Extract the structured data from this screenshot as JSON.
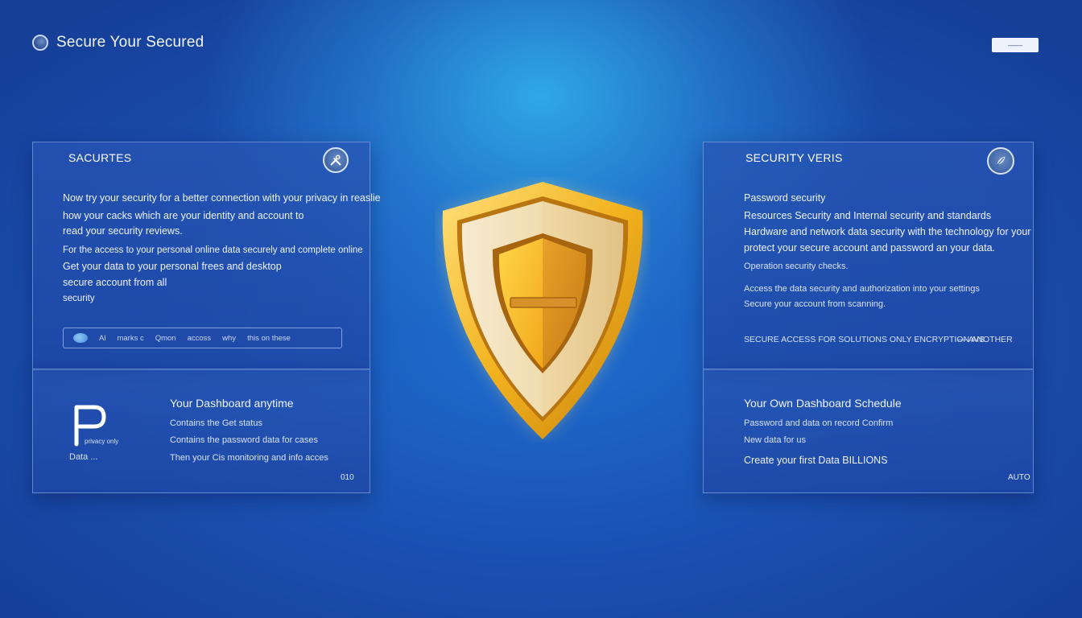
{
  "header": {
    "app_title": "Secure Your Secured",
    "top_button_label": "——"
  },
  "left_top": {
    "title": "SACURTES",
    "lines": [
      "Now try your security for a better connection with your privacy in reaslie",
      "how your cacks  which are your identity and account to",
      "read your security reviews.",
      "For the access to your personal online data securely and complete online",
      "Get your data to your personal frees and desktop",
      "secure account from all",
      "security"
    ],
    "search_tokens": [
      "Al",
      "marks c",
      "Qmon",
      "accoss",
      "why",
      "this on these"
    ]
  },
  "left_bottom": {
    "heading": "Your Dashboard anytime",
    "lines": [
      "Contains the Get status",
      "Contains the password data for cases",
      "Then your Cis monitoring and info acces"
    ],
    "glyph_caption": "privacy only",
    "glyph_label": "Data ...",
    "footer_num": "010"
  },
  "right_top": {
    "title": "SECURITY VERIS",
    "lines": [
      "Password security",
      "Resources Security and Internal security and standards",
      "Hardware and network data security with the technology for your",
      "protect your secure account and password an your data.",
      "Operation security checks.",
      "Access the data security and authorization into your settings",
      "Secure your account from scanning."
    ],
    "footer_line": "SECURE ACCESS FOR SOLUTIONS ONLY ENCRYPTION ANOTHER",
    "footer_tail": "—  AVS"
  },
  "right_bottom": {
    "heading": "Your Own Dashboard Schedule",
    "lines": [
      "Password and data on record Confirm",
      "New data for us",
      "Create your first Data BILLIONS"
    ],
    "footer_mark": "AUTO"
  },
  "colors": {
    "accent_gold": "#F2B21E",
    "shield_cream": "#F3E2B5",
    "background_blue": "#1A4FB0"
  },
  "icons": [
    "circle-logo-icon",
    "tools-icon",
    "feather-icon",
    "shield-icon",
    "search-dot-icon"
  ]
}
